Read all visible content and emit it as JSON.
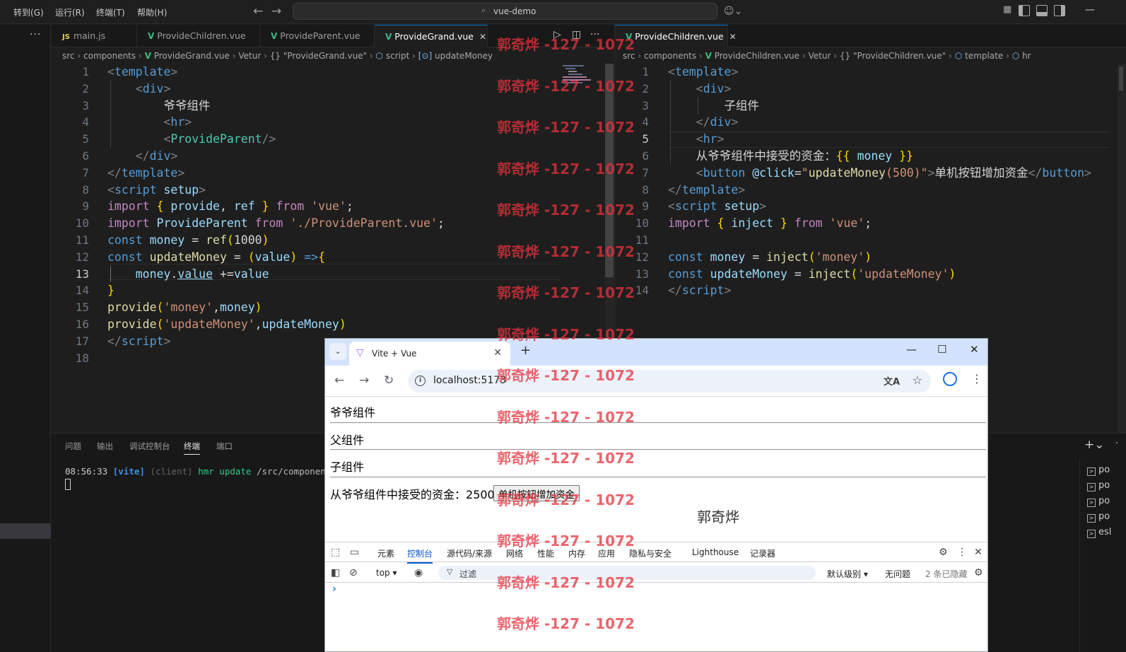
{
  "titlebar": {
    "menus": [
      "转到(G)",
      "运行(R)",
      "终端(T)",
      "帮助(H)"
    ],
    "search_text": "vue-demo"
  },
  "left_group": {
    "tabs": [
      {
        "label": "main.js",
        "kind": "js"
      },
      {
        "label": "ProvideChildren.vue",
        "kind": "vue"
      },
      {
        "label": "ProvideParent.vue",
        "kind": "vue"
      },
      {
        "label": "ProvideGrand.vue",
        "kind": "vue",
        "active": true
      }
    ],
    "breadcrumb": [
      "src",
      "components",
      "ProvideGrand.vue",
      "Vetur",
      "{} \"ProvideGrand.vue\"",
      "script",
      "updateMoney"
    ],
    "line_numbers": [
      "1",
      "2",
      "3",
      "4",
      "5",
      "6",
      "7",
      "8",
      "9",
      "10",
      "11",
      "12",
      "13",
      "14",
      "15",
      "16",
      "17",
      "18"
    ],
    "current_line": "13"
  },
  "right_group": {
    "tabs": [
      {
        "label": "ProvideChildren.vue",
        "kind": "vue",
        "active": true
      }
    ],
    "breadcrumb": [
      "src",
      "components",
      "ProvideChildren.vue",
      "Vetur",
      "{} \"ProvideChildren.vue\"",
      "template",
      "hr"
    ],
    "line_numbers": [
      "1",
      "2",
      "3",
      "4",
      "5",
      "6",
      "7",
      "8",
      "9",
      "10",
      "11",
      "12",
      "13",
      "14"
    ],
    "current_line": "5"
  },
  "panel": {
    "tabs": [
      "问题",
      "输出",
      "调试控制台",
      "终端",
      "端口"
    ],
    "active_tab": "终端",
    "terminal": {
      "time": "08:56:33",
      "tag": "[vite]",
      "client": "(client)",
      "action": "hmr update",
      "path": "/src/components/P"
    },
    "terminal_list": [
      "po",
      "po",
      "po",
      "po",
      "esl"
    ]
  },
  "browser": {
    "tab_title": "Vite + Vue",
    "url": "localhost:5173",
    "page": {
      "grand": "爷爷组件",
      "parent": "父组件",
      "child": "子组件",
      "money_label": "从爷爷组件中接受的资金：",
      "money_value": "2500",
      "button_label": "单机按钮增加资金",
      "signature": "郭奇烨"
    },
    "devtools": {
      "tabs": [
        "元素",
        "控制台",
        "源代码/来源",
        "网络",
        "性能",
        "内存",
        "应用",
        "隐私与安全",
        "Lighthouse",
        "记录器"
      ],
      "active_tab": "控制台",
      "context": "top",
      "filter_placeholder": "过滤",
      "level": "默认级别",
      "issues": "无问题",
      "hidden": "2 条已隐藏",
      "prompt": "›"
    }
  },
  "watermark": "郭奇烨 -127 - 1072"
}
